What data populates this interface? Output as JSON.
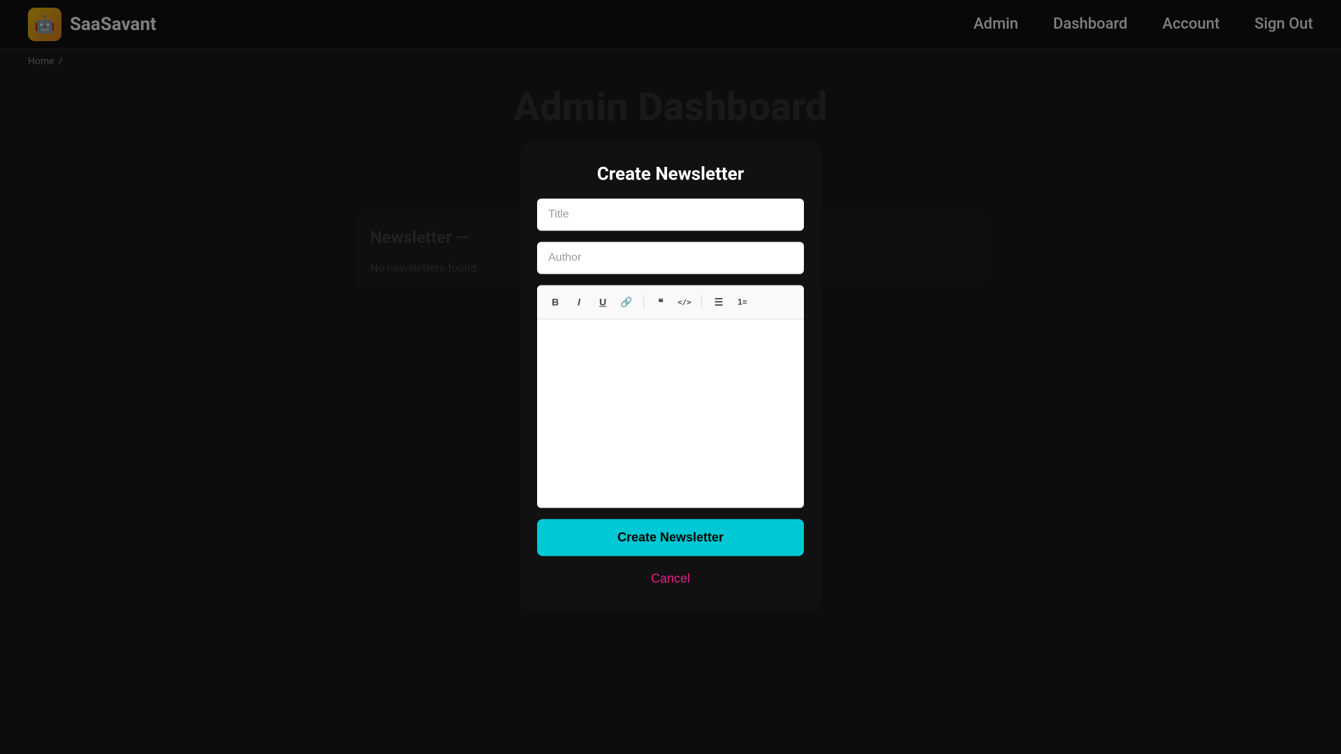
{
  "brand": {
    "logo_emoji": "🤖",
    "name": "SaaSavant"
  },
  "navbar": {
    "links": [
      {
        "id": "admin",
        "label": "Admin"
      },
      {
        "id": "dashboard",
        "label": "Dashboard"
      },
      {
        "id": "account",
        "label": "Account"
      },
      {
        "id": "signout",
        "label": "Sign Out"
      }
    ]
  },
  "breadcrumb": {
    "home": "Home",
    "separator": "/"
  },
  "background": {
    "title": "Admin Dashboard",
    "no_newsletters": "No newsletters found.",
    "section_title": "Newsletter —"
  },
  "modal": {
    "title": "Create Newsletter",
    "title_placeholder": "Title",
    "author_placeholder": "Author",
    "toolbar": {
      "bold": "B",
      "italic": "I",
      "underline": "U",
      "link": "🔗",
      "blockquote": "❝",
      "code": "</>",
      "unordered_list": "≡",
      "ordered_list": "≡₁"
    },
    "create_button": "Create Newsletter",
    "cancel_button": "Cancel"
  },
  "colors": {
    "accent": "#00c8d4",
    "cancel": "#e91e8c",
    "background": "#1a1a1a",
    "modal_bg": "#111111",
    "input_bg": "#ffffff"
  }
}
